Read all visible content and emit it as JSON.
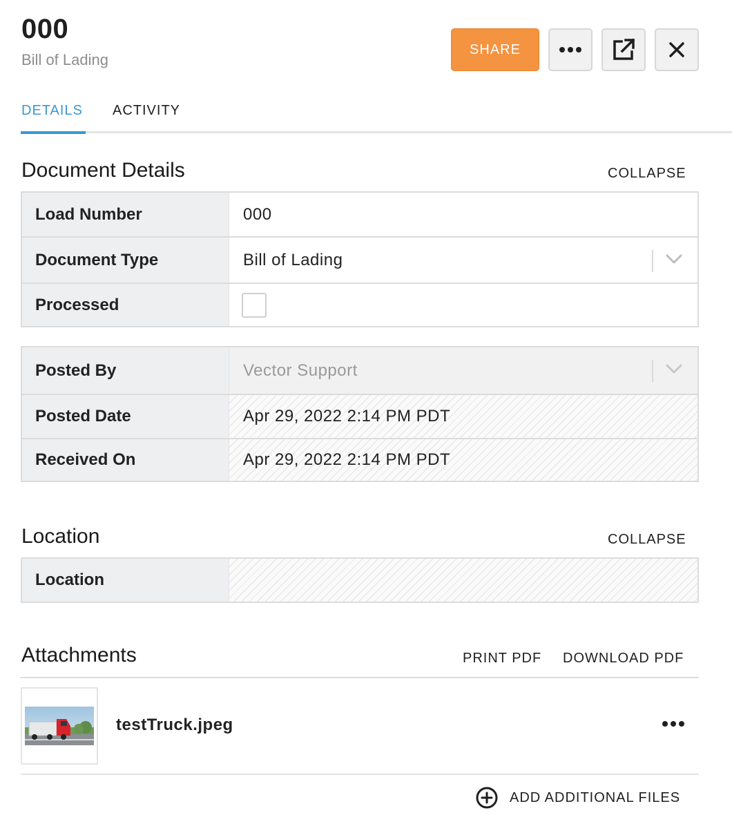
{
  "header": {
    "title": "000",
    "subtitle": "Bill of Lading",
    "share_label": "SHARE"
  },
  "icons": {
    "more": "more-horizontal-icon",
    "open_external": "external-link-icon",
    "close": "close-icon",
    "chevron": "chevron-down-icon",
    "add": "plus-circle-icon"
  },
  "colors": {
    "accent_blue": "#3a98d3",
    "share_orange": "#f49340",
    "label_bg": "#eeeff1"
  },
  "tabs": [
    {
      "label": "DETAILS",
      "active": true
    },
    {
      "label": "ACTIVITY",
      "active": false
    }
  ],
  "document_details": {
    "heading": "Document Details",
    "collapse_label": "COLLAPSE",
    "fields": {
      "load_number": {
        "label": "Load Number",
        "value": "000"
      },
      "document_type": {
        "label": "Document Type",
        "value": "Bill of Lading"
      },
      "processed": {
        "label": "Processed",
        "checked": false
      }
    },
    "meta": {
      "posted_by": {
        "label": "Posted By",
        "value": "Vector Support"
      },
      "posted_date": {
        "label": "Posted Date",
        "value": "Apr 29, 2022 2:14 PM PDT"
      },
      "received_on": {
        "label": "Received On",
        "value": "Apr 29, 2022 2:14 PM PDT"
      }
    }
  },
  "location": {
    "heading": "Location",
    "collapse_label": "COLLAPSE",
    "field": {
      "label": "Location",
      "value": ""
    }
  },
  "attachments": {
    "heading": "Attachments",
    "print_label": "PRINT PDF",
    "download_label": "DOWNLOAD PDF",
    "files": [
      {
        "name": "testTruck.jpeg"
      }
    ],
    "add_label": "ADD ADDITIONAL FILES"
  }
}
